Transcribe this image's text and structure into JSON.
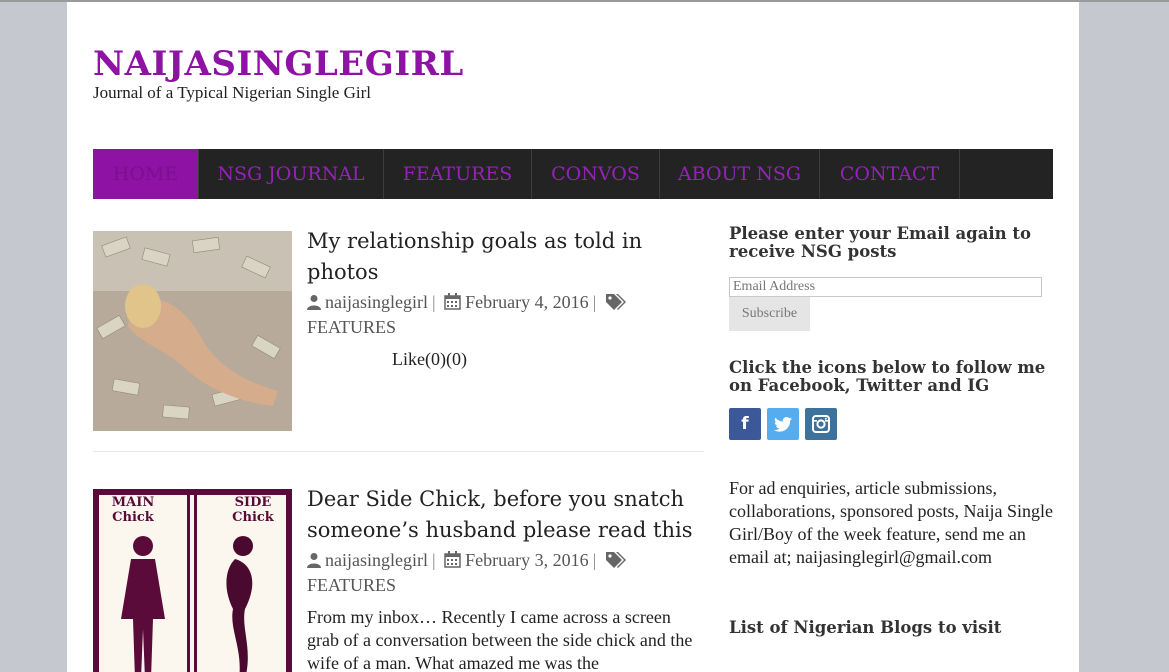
{
  "site": {
    "title": "NAIJASINGLEGIRL",
    "tagline": "Journal of a Typical Nigerian Single Girl",
    "brand_color": "#8e13a5"
  },
  "nav": {
    "items": [
      {
        "label": "HOME",
        "active": true
      },
      {
        "label": "NSG JOURNAL",
        "active": false
      },
      {
        "label": "FEATURES",
        "active": false
      },
      {
        "label": "CONVOS",
        "active": false
      },
      {
        "label": "ABOUT NSG",
        "active": false
      },
      {
        "label": "CONTACT",
        "active": false
      }
    ]
  },
  "posts": [
    {
      "title": "My relationship goals as told in photos",
      "author": "naijasinglegirl",
      "date": "February 4, 2016",
      "category": "FEATURES",
      "like_text": "Like(0)(0)",
      "thumbnail": "woman-on-money-photo"
    },
    {
      "title": "Dear Side Chick, before you snatch someone’s husband please read this",
      "author": "naijasinglegirl",
      "date": "February 3, 2016",
      "category": "FEATURES",
      "excerpt": "From my inbox… Recently I came across a screen grab of a conversation between the side chick and the wife of a man.  What amazed me was the",
      "thumbnail": "main-chick-side-chick-graphic",
      "thumb_labels": {
        "left": "MAIN Chick",
        "right": "SIDE Chick"
      }
    }
  ],
  "sidebar": {
    "subscribe_title": "Please enter your Email again to receive NSG posts",
    "email_placeholder": "Email Address",
    "subscribe_label": "Subscribe",
    "follow_title": "Click the icons below to follow me on Facebook, Twitter and IG",
    "social": [
      {
        "icon": "facebook-icon",
        "glyph": "f",
        "color": "#3b5998"
      },
      {
        "icon": "twitter-icon",
        "glyph": "",
        "color": "#55acee"
      },
      {
        "icon": "instagram-icon",
        "glyph": "",
        "color": "#3f729b"
      }
    ],
    "ad_text": "For ad enquiries, article submissions, collaborations, sponsored posts, Naija Single Girl/Boy of the week feature, send me an email at; naijasinglegirl@gmail.com",
    "blogs_title": "List of Nigerian Blogs to visit"
  }
}
